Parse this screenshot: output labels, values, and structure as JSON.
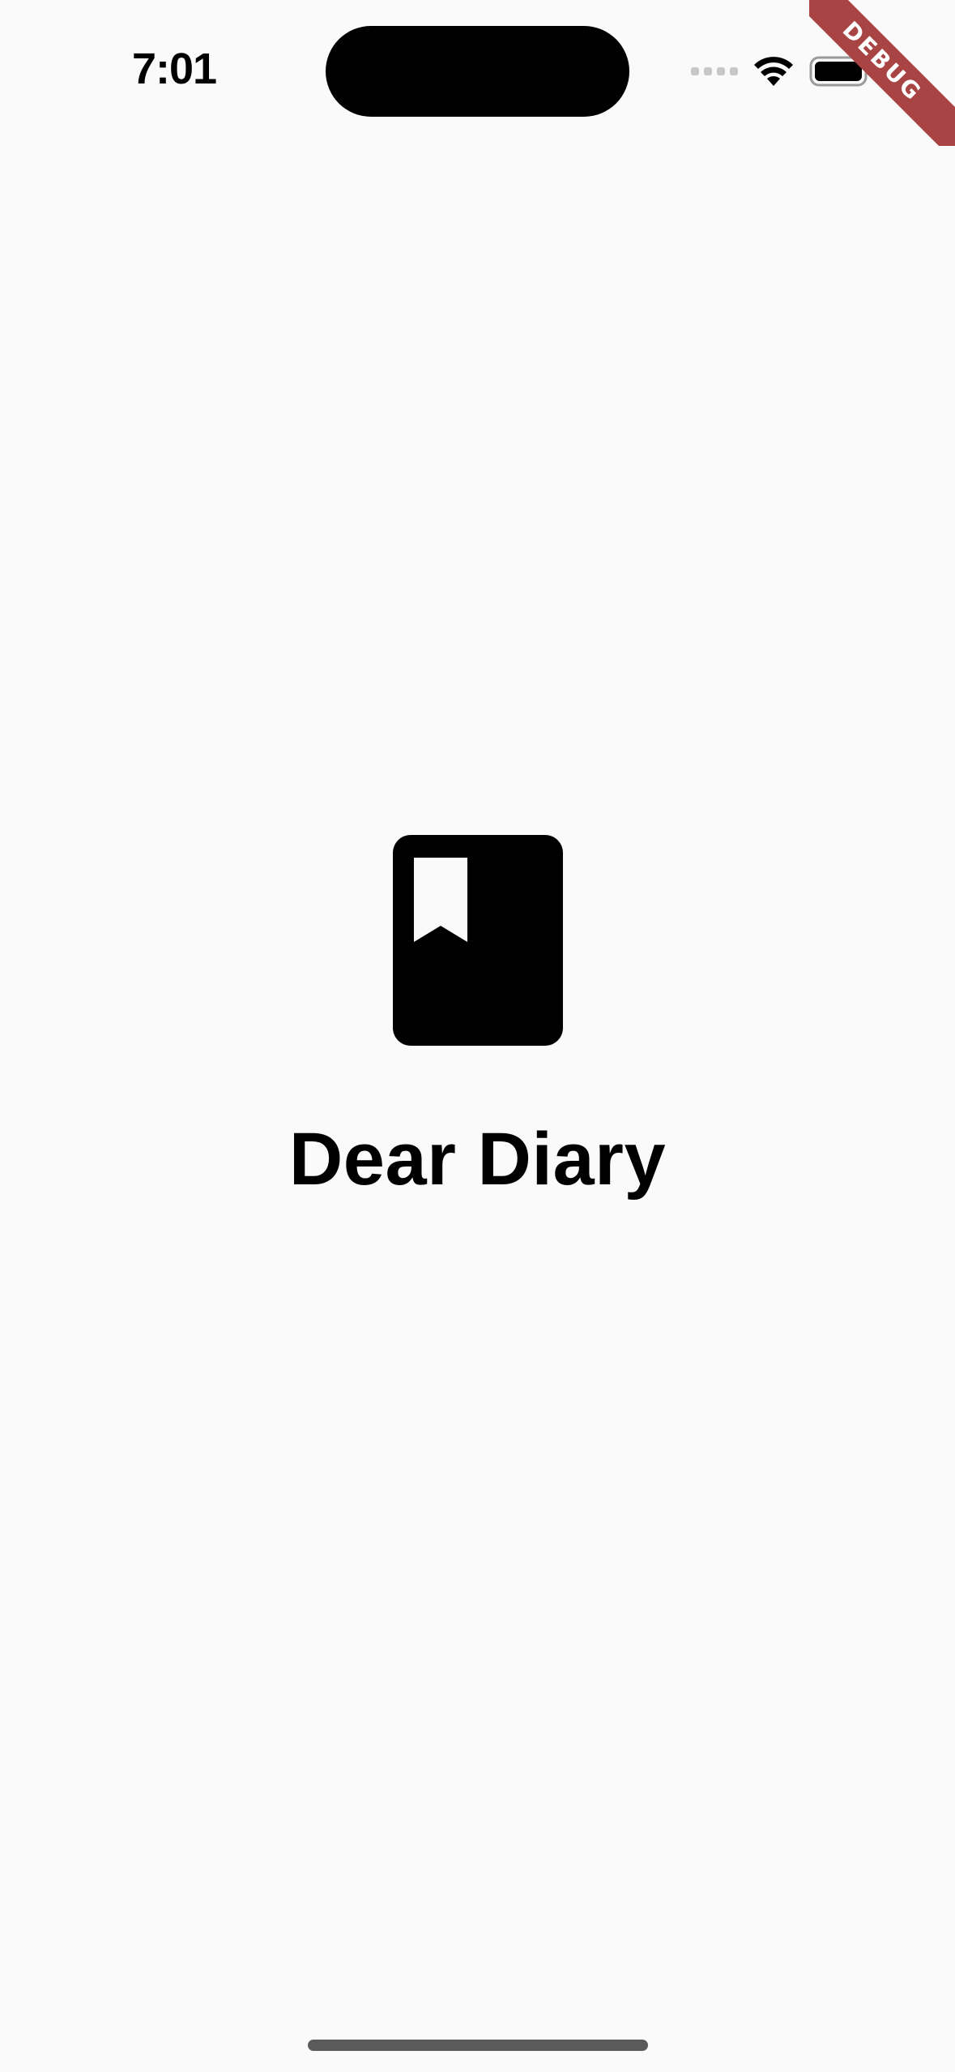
{
  "status_bar": {
    "time": "7:01"
  },
  "debug_banner": {
    "label": "DEBUG",
    "color": "#a94444"
  },
  "splash": {
    "icon": "book-bookmark-icon",
    "title": "Dear Diary"
  },
  "colors": {
    "background": "#fafafa",
    "foreground": "#000000"
  }
}
